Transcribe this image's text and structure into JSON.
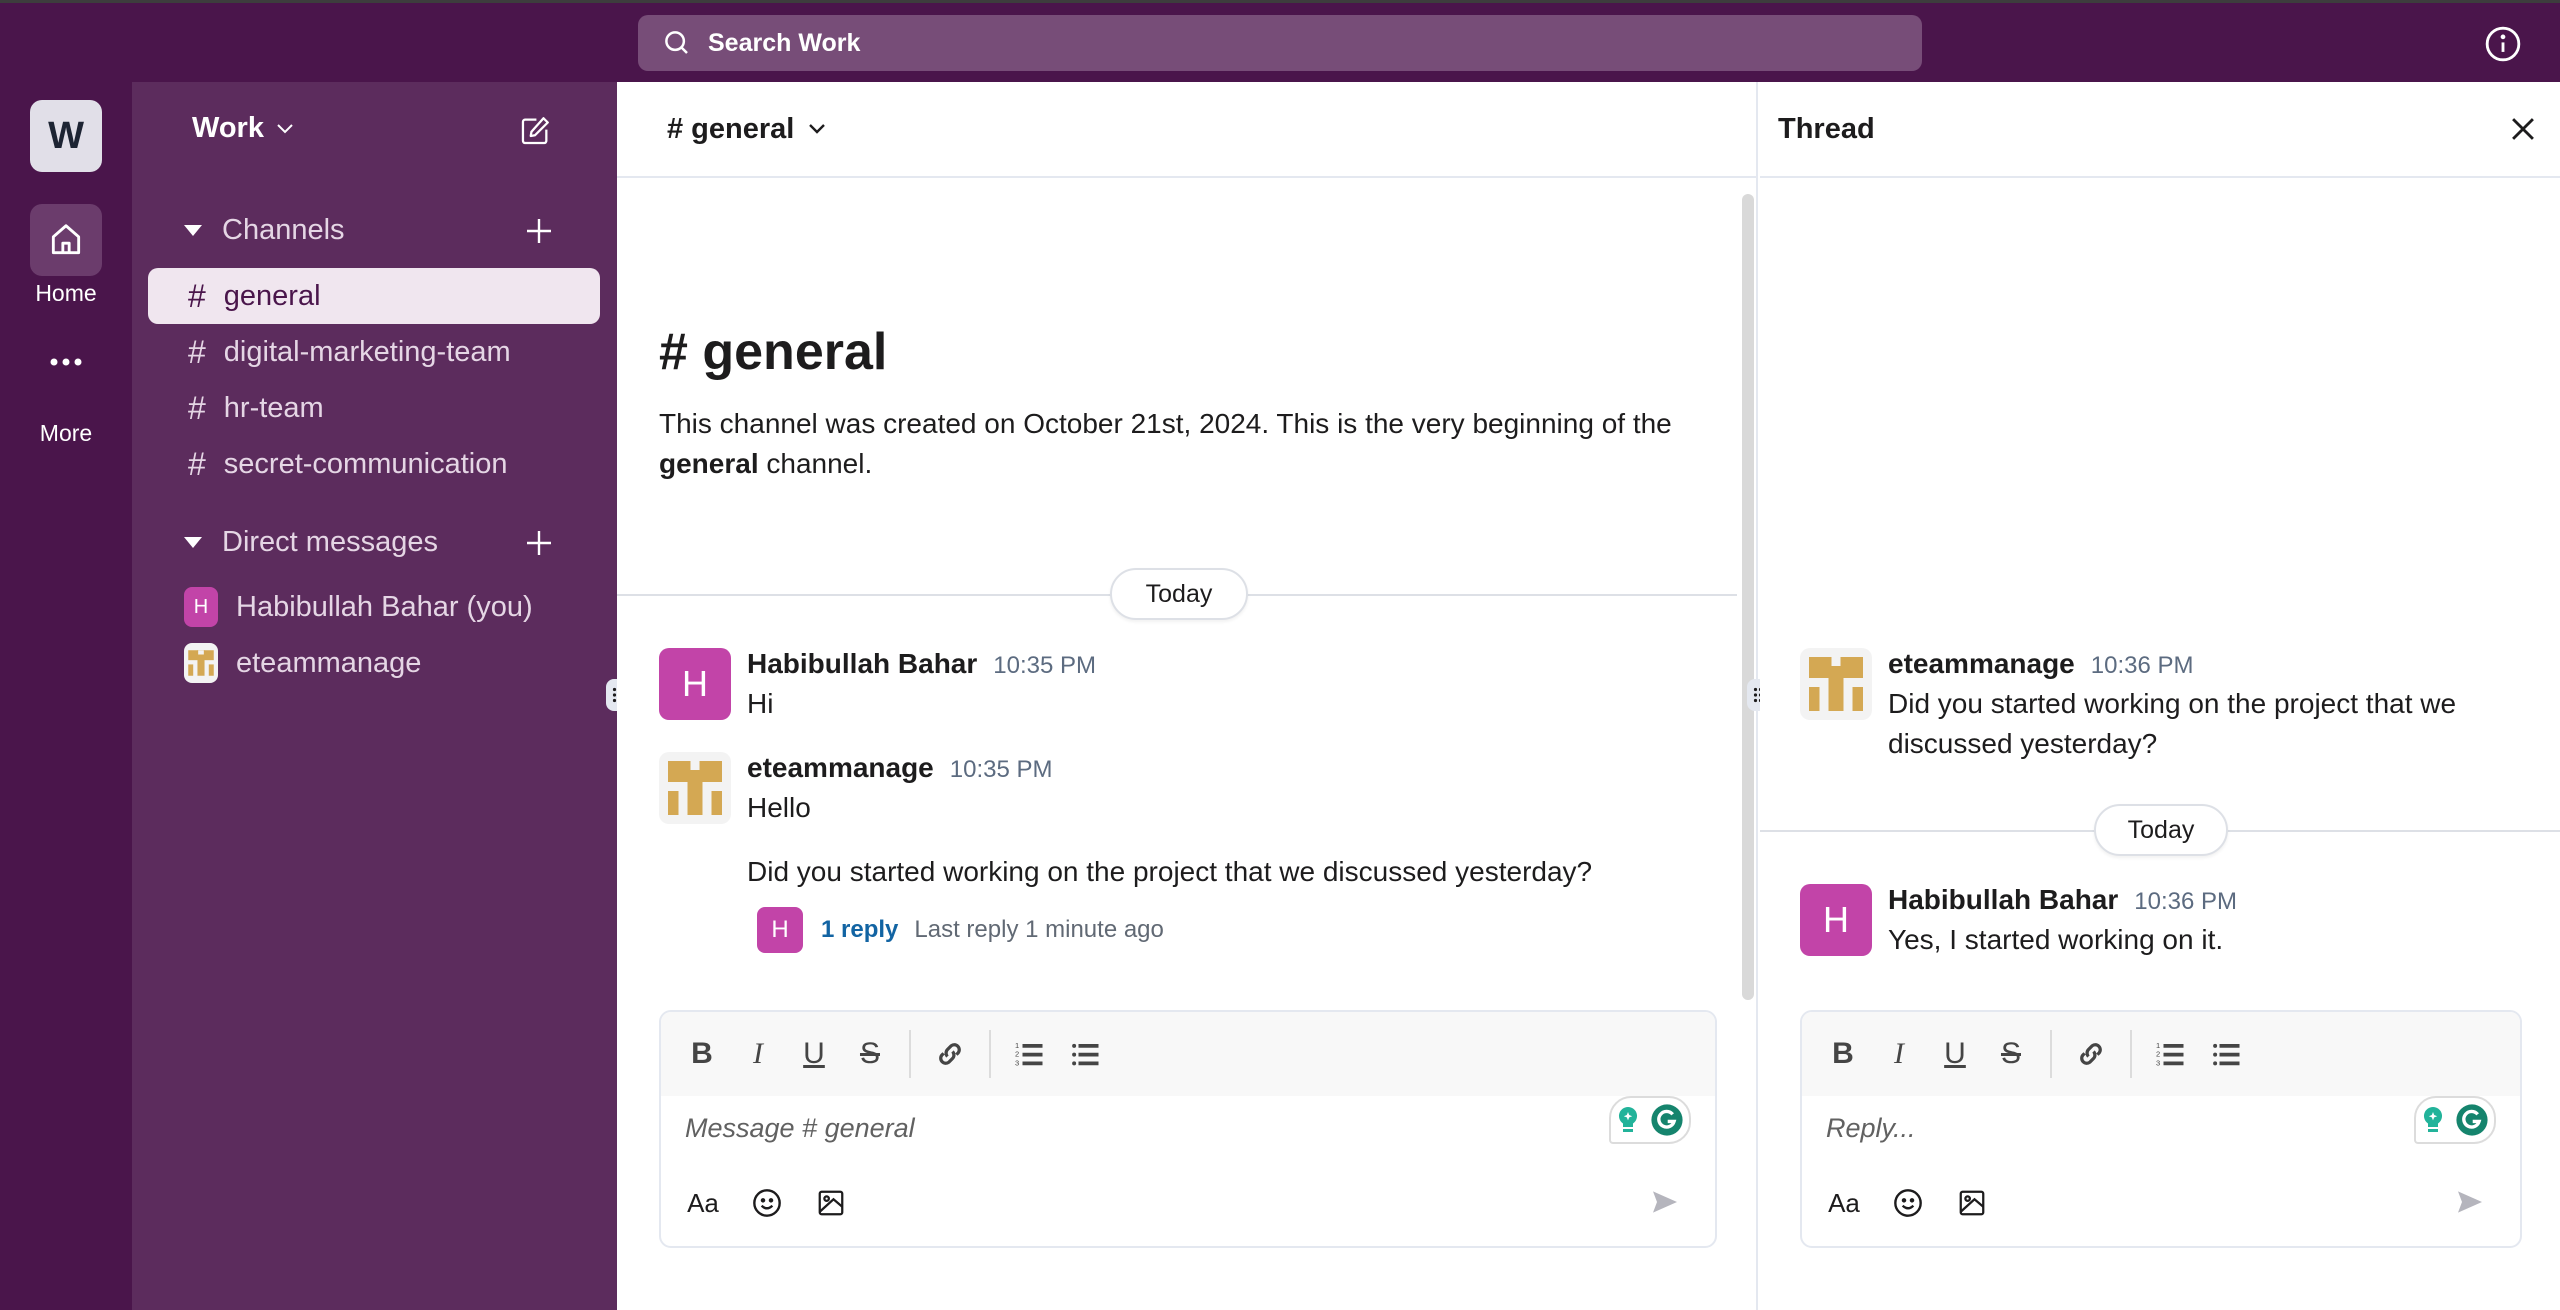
{
  "topbar": {
    "search_placeholder": "Search Work",
    "info_icon": "info-icon"
  },
  "rail": {
    "workspace_initial": "W",
    "home_label": "Home",
    "more_label": "More"
  },
  "sidebar": {
    "workspace_name": "Work",
    "channels_header": "Channels",
    "channels": [
      {
        "name": "general",
        "active": true
      },
      {
        "name": "digital-marketing-team",
        "active": false
      },
      {
        "name": "hr-team",
        "active": false
      },
      {
        "name": "secret-communication",
        "active": false
      }
    ],
    "dm_header": "Direct messages",
    "dms": [
      {
        "name": "Habibullah Bahar (you)",
        "initial": "H"
      },
      {
        "name": "eteammanage",
        "initial": ""
      }
    ]
  },
  "main": {
    "channel_title": "# general",
    "intro_title": "# general",
    "intro_text_prefix": "This channel was created on October 21st, 2024. This is the very beginning of the ",
    "intro_text_bold": "general",
    "intro_text_suffix": " channel.",
    "date_divider": "Today",
    "messages": [
      {
        "author": "Habibullah Bahar",
        "initial": "H",
        "time": "10:35 PM",
        "lines": [
          "Hi"
        ]
      },
      {
        "author": "eteammanage",
        "initial": "",
        "time": "10:35 PM",
        "lines": [
          "Hello",
          "Did you started working on the project that we discussed yesterday?"
        ]
      }
    ],
    "thread_summary": {
      "avatar_initial": "H",
      "reply_count": "1 reply",
      "last_reply": "Last reply 1 minute ago"
    },
    "composer_placeholder": "Message # general"
  },
  "thread": {
    "title": "Thread",
    "parent": {
      "author": "eteammanage",
      "time": "10:36 PM",
      "text": "Did you started working on the project that we discussed yesterday?"
    },
    "date_divider": "Today",
    "replies": [
      {
        "author": "Habibullah Bahar",
        "initial": "H",
        "time": "10:36 PM",
        "text": "Yes, I started working on it."
      }
    ],
    "composer_placeholder": "Reply..."
  },
  "composer_toolbar": {
    "bold": "B",
    "italic": "I",
    "underline": "U",
    "strike": "S",
    "format": "Aa"
  },
  "colors": {
    "brand": "#4a154b",
    "sidebar": "#5c2c5d",
    "avatar_h": "#c244a8",
    "link": "#1264a3",
    "avatar_team": "#d4a853"
  }
}
